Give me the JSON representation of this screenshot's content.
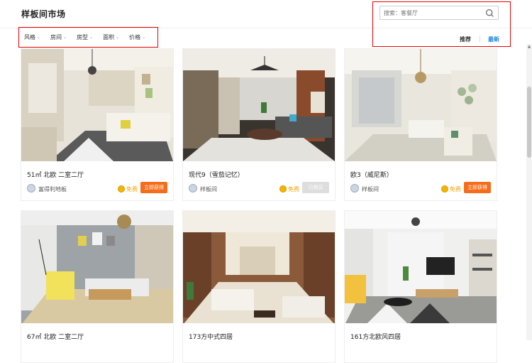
{
  "header": {
    "title": "样板间市场",
    "search_placeholder": "搜索：客餐厅",
    "sort_recommended": "推荐",
    "sort_latest": "最新"
  },
  "filters": [
    "风格",
    "房间",
    "房型",
    "面积",
    "价格"
  ],
  "cards": [
    {
      "name": "51㎡ 北欧 二室二厅",
      "author": "富得利地板",
      "free": "免费",
      "button": "立即获得",
      "button_state": "active"
    },
    {
      "name": "现代9（雪茄记忆）",
      "author": "样板间",
      "free": "免费",
      "button": "已购买",
      "button_state": "disabled"
    },
    {
      "name": "欧3（威尼斯）",
      "author": "样板间",
      "free": "免费",
      "button": "立即获得",
      "button_state": "active"
    },
    {
      "name": "67㎡ 北欧 二室二厅",
      "author": "",
      "free": "",
      "button": "",
      "button_state": ""
    },
    {
      "name": "173方中式四居",
      "author": "",
      "free": "",
      "button": "",
      "button_state": ""
    },
    {
      "name": "161方北欧风四居",
      "author": "",
      "free": "",
      "button": "",
      "button_state": ""
    }
  ],
  "colors": {
    "accent_blue": "#1e88e5",
    "button_orange": "#f56c1a",
    "coin": "#f5b400",
    "highlight_red": "#e00000"
  }
}
